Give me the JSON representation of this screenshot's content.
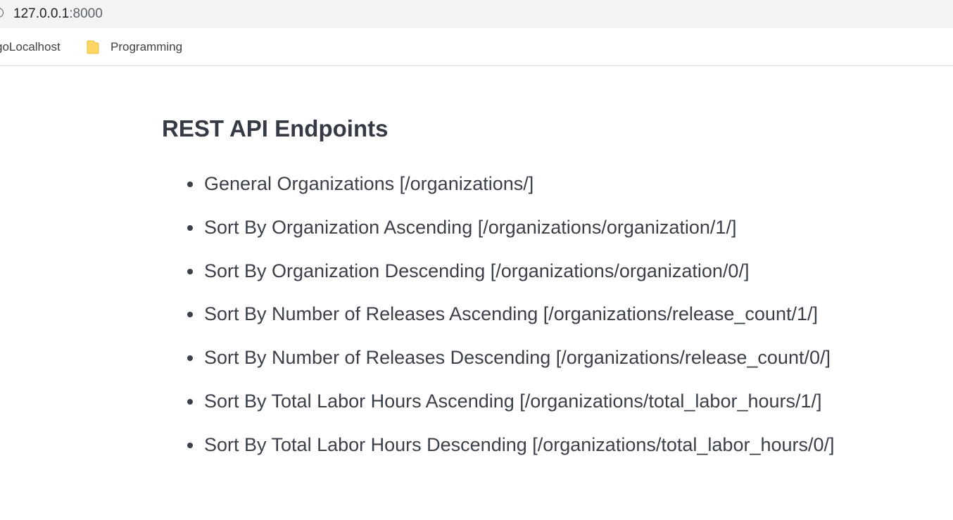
{
  "browser": {
    "url_host": "127.0.0.1",
    "url_port": ":8000",
    "bookmarks": [
      {
        "label": "goLocalhost",
        "icon": "page-icon"
      },
      {
        "label": "Programming",
        "icon": "folder-icon"
      }
    ]
  },
  "page": {
    "title": "REST API Endpoints",
    "endpoints": [
      {
        "text": "General Organizations [/organizations/]"
      },
      {
        "text": "Sort By Organization Ascending [/organizations/organization/1/]"
      },
      {
        "text": "Sort By Organization Descending [/organizations/organization/0/]"
      },
      {
        "text": "Sort By Number of Releases Ascending [/organizations/release_count/1/]"
      },
      {
        "text": "Sort By Number of Releases Descending [/organizations/release_count/0/]"
      },
      {
        "text": "Sort By Total Labor Hours Ascending [/organizations/total_labor_hours/1/]"
      },
      {
        "text": "Sort By Total Labor Hours Descending [/organizations/total_labor_hours/0/]"
      }
    ]
  },
  "colors": {
    "text": "#3a3f48",
    "title": "#353a45",
    "toolbar_bg": "#f1f3f4",
    "folder": "#fdd663"
  }
}
